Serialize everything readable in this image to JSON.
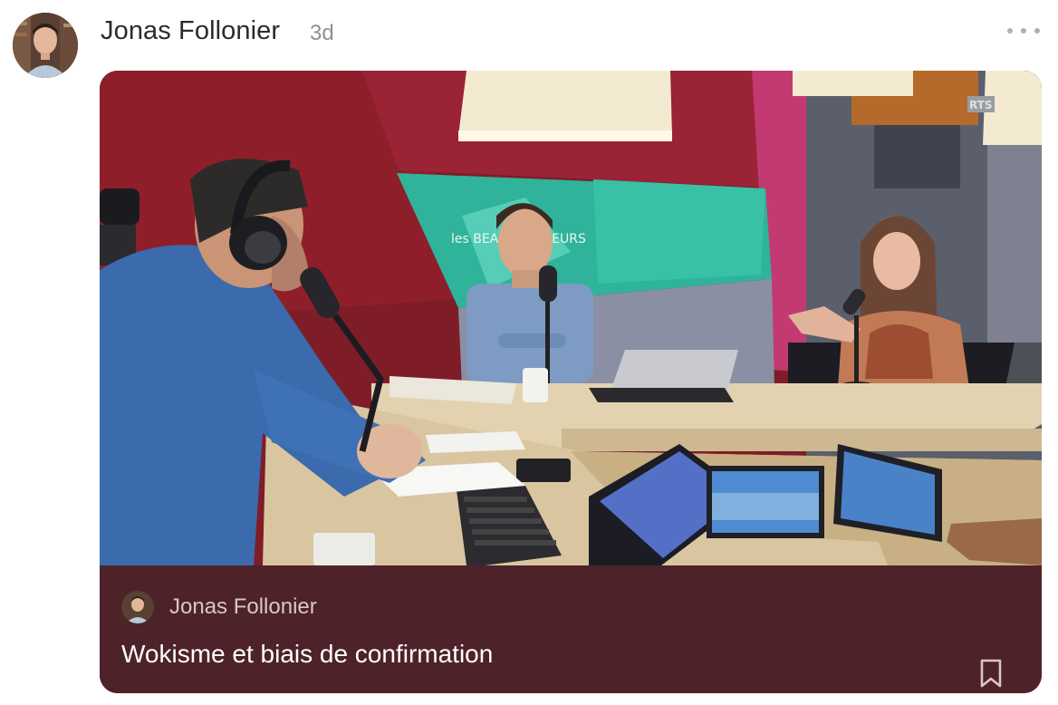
{
  "post": {
    "author": "Jonas Follonier",
    "time": "3d"
  },
  "card": {
    "author": "Jonas Follonier",
    "title": "Wokisme et biais de confirmation",
    "media_sign": "les BEAUX PARLEURS",
    "media_watermark": "RTS"
  },
  "icons": {
    "more": "more-horizontal-icon",
    "bookmark": "bookmark-icon"
  },
  "colors": {
    "card_footer": "#4e2229",
    "footer_author": "#d9c7c9",
    "title": "#ffffff"
  }
}
